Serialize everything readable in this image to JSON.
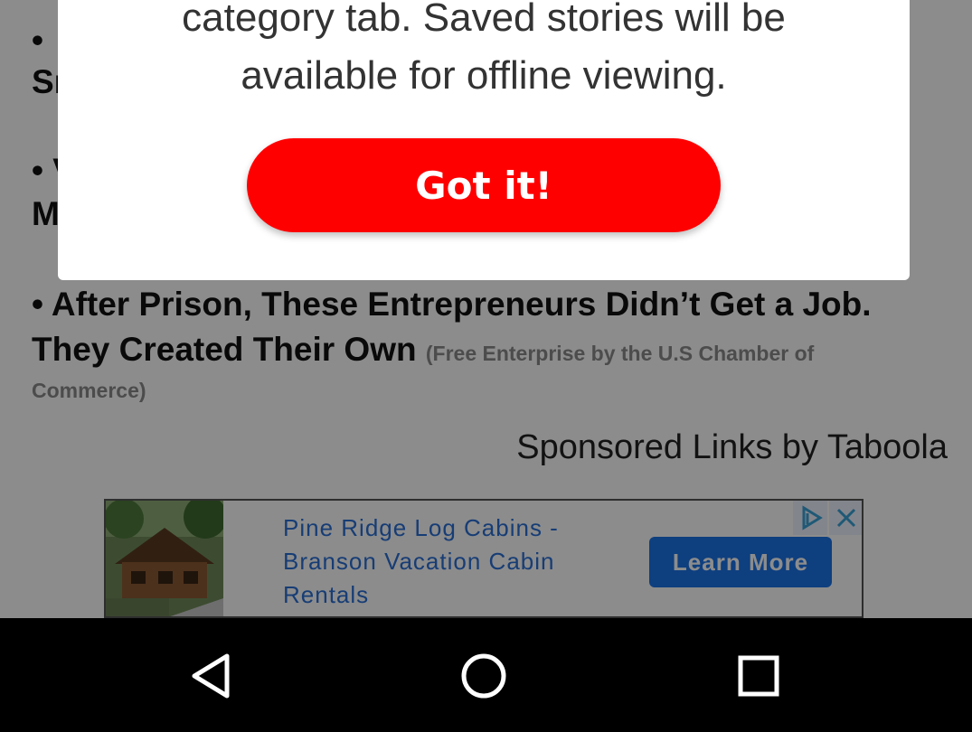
{
  "article": {
    "bullet1_start": "• ",
    "bullet1_cont": "Sı",
    "bullet2_start": "• V",
    "bullet2_cont": "M",
    "story": {
      "title": "• After Prison, These Entrepreneurs Didn’t Get a Job. They Created Their Own",
      "source_a": "(Free Enterprise by the U.S Chamber of",
      "source_b": "Commerce)"
    },
    "sponsored_label": "Sponsored Links by Taboola"
  },
  "ad": {
    "text": "Pine Ridge Log Cabins - Branson Vacation Cabin Rentals",
    "cta_label": "Learn More",
    "choices_icon": "adchoices-icon",
    "close_icon": "close-icon",
    "accent": "#1a73e8"
  },
  "dialog": {
    "message_line1": "category tab. Saved stories will be",
    "message_line2": "available for offline viewing.",
    "button_label": "Got it!",
    "button_color": "#ff0000"
  },
  "navbar": {
    "back_icon": "back-triangle-icon",
    "home_icon": "home-circle-icon",
    "recents_icon": "recents-square-icon"
  }
}
